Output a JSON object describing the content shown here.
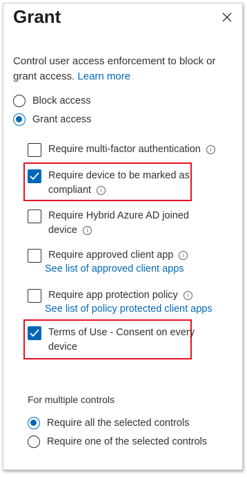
{
  "blade": {
    "title": "Grant",
    "description": "Control user access enforcement to block or grant access.",
    "learn_more": "Learn more"
  },
  "access": {
    "block_label": "Block access",
    "grant_label": "Grant access",
    "selected": "grant"
  },
  "controls": {
    "mfa": {
      "label": "Require multi-factor authentication",
      "checked": false
    },
    "compliant": {
      "label_line1": "Require device to be marked as",
      "label_line2": "compliant",
      "checked": true
    },
    "hybrid": {
      "label_line1": "Require Hybrid Azure AD joined",
      "label_line2": "device",
      "checked": false
    },
    "approved_app": {
      "label": "Require approved client app",
      "link": "See list of approved client apps",
      "checked": false
    },
    "app_protection": {
      "label": "Require app protection policy",
      "link": "See list of policy protected client apps",
      "checked": false
    },
    "terms": {
      "label_line1": "Terms of Use - Consent on every",
      "label_line2": "device",
      "checked": true
    }
  },
  "multiple": {
    "heading": "For multiple controls",
    "require_all": "Require all the selected controls",
    "require_one": "Require one of the selected controls",
    "selected": "all"
  },
  "icons": {
    "info": "i",
    "highlight_color": "#e81123",
    "accent": "#0067b8"
  }
}
